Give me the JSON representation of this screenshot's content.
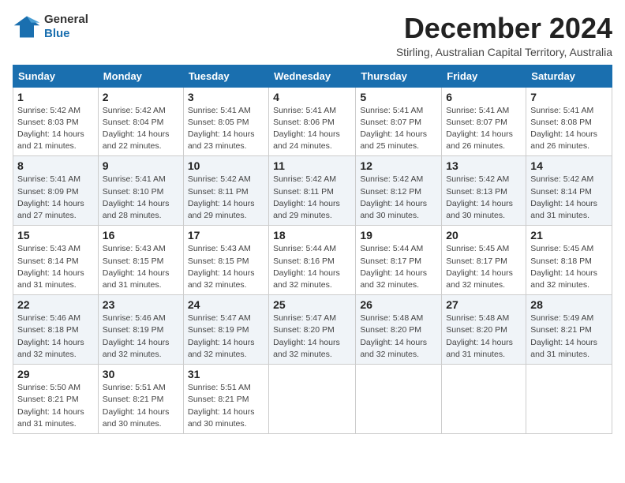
{
  "logo": {
    "general": "General",
    "blue": "Blue"
  },
  "header": {
    "month": "December 2024",
    "location": "Stirling, Australian Capital Territory, Australia"
  },
  "weekdays": [
    "Sunday",
    "Monday",
    "Tuesday",
    "Wednesday",
    "Thursday",
    "Friday",
    "Saturday"
  ],
  "weeks": [
    [
      {
        "day": "1",
        "sunrise": "5:42 AM",
        "sunset": "8:03 PM",
        "daylight": "14 hours and 21 minutes."
      },
      {
        "day": "2",
        "sunrise": "5:42 AM",
        "sunset": "8:04 PM",
        "daylight": "14 hours and 22 minutes."
      },
      {
        "day": "3",
        "sunrise": "5:41 AM",
        "sunset": "8:05 PM",
        "daylight": "14 hours and 23 minutes."
      },
      {
        "day": "4",
        "sunrise": "5:41 AM",
        "sunset": "8:06 PM",
        "daylight": "14 hours and 24 minutes."
      },
      {
        "day": "5",
        "sunrise": "5:41 AM",
        "sunset": "8:07 PM",
        "daylight": "14 hours and 25 minutes."
      },
      {
        "day": "6",
        "sunrise": "5:41 AM",
        "sunset": "8:07 PM",
        "daylight": "14 hours and 26 minutes."
      },
      {
        "day": "7",
        "sunrise": "5:41 AM",
        "sunset": "8:08 PM",
        "daylight": "14 hours and 26 minutes."
      }
    ],
    [
      {
        "day": "8",
        "sunrise": "5:41 AM",
        "sunset": "8:09 PM",
        "daylight": "14 hours and 27 minutes."
      },
      {
        "day": "9",
        "sunrise": "5:41 AM",
        "sunset": "8:10 PM",
        "daylight": "14 hours and 28 minutes."
      },
      {
        "day": "10",
        "sunrise": "5:42 AM",
        "sunset": "8:11 PM",
        "daylight": "14 hours and 29 minutes."
      },
      {
        "day": "11",
        "sunrise": "5:42 AM",
        "sunset": "8:11 PM",
        "daylight": "14 hours and 29 minutes."
      },
      {
        "day": "12",
        "sunrise": "5:42 AM",
        "sunset": "8:12 PM",
        "daylight": "14 hours and 30 minutes."
      },
      {
        "day": "13",
        "sunrise": "5:42 AM",
        "sunset": "8:13 PM",
        "daylight": "14 hours and 30 minutes."
      },
      {
        "day": "14",
        "sunrise": "5:42 AM",
        "sunset": "8:14 PM",
        "daylight": "14 hours and 31 minutes."
      }
    ],
    [
      {
        "day": "15",
        "sunrise": "5:43 AM",
        "sunset": "8:14 PM",
        "daylight": "14 hours and 31 minutes."
      },
      {
        "day": "16",
        "sunrise": "5:43 AM",
        "sunset": "8:15 PM",
        "daylight": "14 hours and 31 minutes."
      },
      {
        "day": "17",
        "sunrise": "5:43 AM",
        "sunset": "8:15 PM",
        "daylight": "14 hours and 32 minutes."
      },
      {
        "day": "18",
        "sunrise": "5:44 AM",
        "sunset": "8:16 PM",
        "daylight": "14 hours and 32 minutes."
      },
      {
        "day": "19",
        "sunrise": "5:44 AM",
        "sunset": "8:17 PM",
        "daylight": "14 hours and 32 minutes."
      },
      {
        "day": "20",
        "sunrise": "5:45 AM",
        "sunset": "8:17 PM",
        "daylight": "14 hours and 32 minutes."
      },
      {
        "day": "21",
        "sunrise": "5:45 AM",
        "sunset": "8:18 PM",
        "daylight": "14 hours and 32 minutes."
      }
    ],
    [
      {
        "day": "22",
        "sunrise": "5:46 AM",
        "sunset": "8:18 PM",
        "daylight": "14 hours and 32 minutes."
      },
      {
        "day": "23",
        "sunrise": "5:46 AM",
        "sunset": "8:19 PM",
        "daylight": "14 hours and 32 minutes."
      },
      {
        "day": "24",
        "sunrise": "5:47 AM",
        "sunset": "8:19 PM",
        "daylight": "14 hours and 32 minutes."
      },
      {
        "day": "25",
        "sunrise": "5:47 AM",
        "sunset": "8:20 PM",
        "daylight": "14 hours and 32 minutes."
      },
      {
        "day": "26",
        "sunrise": "5:48 AM",
        "sunset": "8:20 PM",
        "daylight": "14 hours and 32 minutes."
      },
      {
        "day": "27",
        "sunrise": "5:48 AM",
        "sunset": "8:20 PM",
        "daylight": "14 hours and 31 minutes."
      },
      {
        "day": "28",
        "sunrise": "5:49 AM",
        "sunset": "8:21 PM",
        "daylight": "14 hours and 31 minutes."
      }
    ],
    [
      {
        "day": "29",
        "sunrise": "5:50 AM",
        "sunset": "8:21 PM",
        "daylight": "14 hours and 31 minutes."
      },
      {
        "day": "30",
        "sunrise": "5:51 AM",
        "sunset": "8:21 PM",
        "daylight": "14 hours and 30 minutes."
      },
      {
        "day": "31",
        "sunrise": "5:51 AM",
        "sunset": "8:21 PM",
        "daylight": "14 hours and 30 minutes."
      },
      null,
      null,
      null,
      null
    ]
  ]
}
